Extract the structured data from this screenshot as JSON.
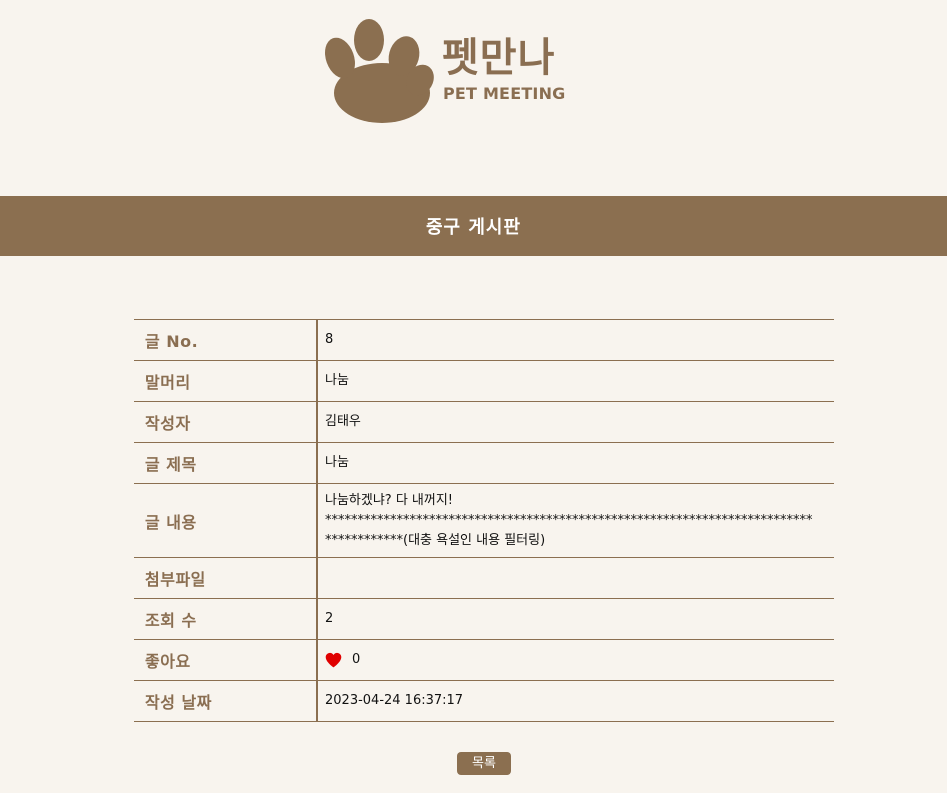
{
  "logo": {
    "title_ko": "펫만나",
    "title_en": "PET MEETING",
    "color": "#8a6e51",
    "icon": "paw-icon"
  },
  "banner": {
    "title": "중구 게시판",
    "color": "#8b6f50"
  },
  "post": {
    "rows": [
      {
        "label": "글 No.",
        "value": "8"
      },
      {
        "label": "말머리",
        "value": "나눔"
      },
      {
        "label": "작성자",
        "value": "김태우"
      },
      {
        "label": "글 제목",
        "value": "나눔"
      },
      {
        "label": "글 내용",
        "value": "나눔하겠냐? 다 내꺼지!\n***************************************************************************************(대충 욕설인 내용 필터링)"
      },
      {
        "label": "첨부파일",
        "value": ""
      },
      {
        "label": "조회 수",
        "value": "2"
      },
      {
        "label": "좋아요",
        "value": "0"
      },
      {
        "label": "작성 날짜",
        "value": "2023-04-24 16:37:17"
      }
    ]
  },
  "like_icon": "heart-icon",
  "like_color": "#e00000",
  "actions": {
    "list_label": "목록"
  }
}
